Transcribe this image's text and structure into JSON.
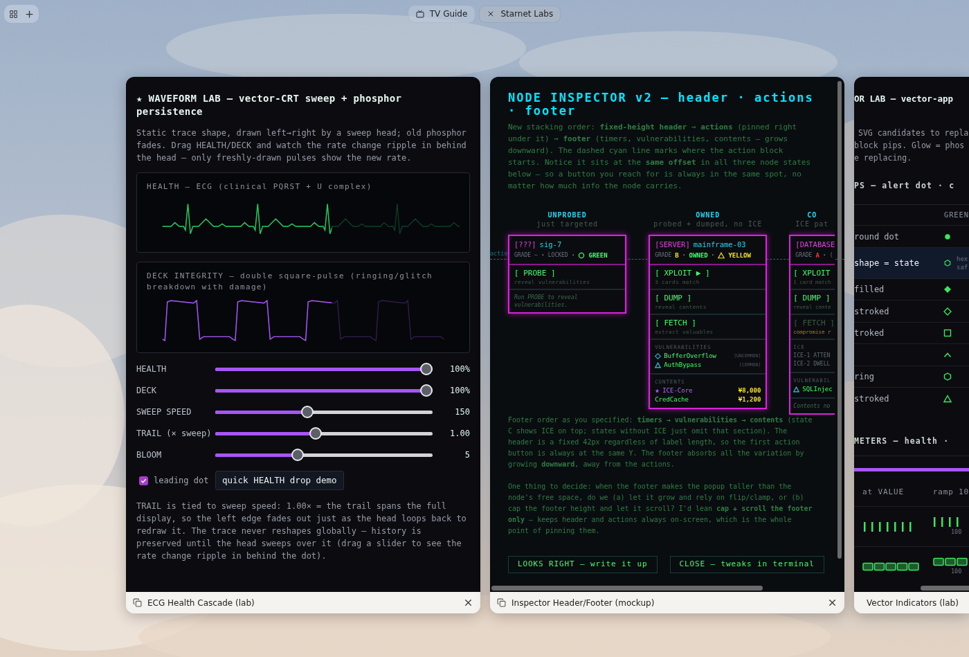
{
  "tabs": [
    {
      "label": "TV Guide",
      "selected": false
    },
    {
      "label": "Starnet Labs",
      "selected": true
    }
  ],
  "waveform_lab": {
    "title": "★ WAVEFORM LAB — vector-CRT sweep + phosphor persistence",
    "intro": "Static trace shape, drawn left→right by a sweep head; old phosphor fades. Drag HEALTH/DECK and watch the rate change ripple in behind the head — only freshly-drawn pulses show the new rate.",
    "scopes": [
      {
        "label": "HEALTH — ECG (clinical PQRST + U complex)",
        "kind": "ecg"
      },
      {
        "label": "DECK INTEGRITY — double square-pulse (ringing/glitch breakdown with damage)",
        "kind": "square"
      }
    ],
    "sliders": [
      {
        "label": "HEALTH",
        "level": 1,
        "reading": "100%"
      },
      {
        "label": "DECK",
        "level": 1,
        "reading": "100%"
      },
      {
        "label": "SWEEP SPEED",
        "level": 0.42,
        "reading": "150"
      },
      {
        "label": "TRAIL (× sweep)",
        "level": 0.46,
        "reading": "1.00"
      },
      {
        "label": "BLOOM",
        "level": 0.37,
        "reading": "5"
      }
    ],
    "checkbox": {
      "label": "leading dot",
      "checked": true
    },
    "button": "quick HEALTH drop demo",
    "note": "TRAIL is tied to sweep speed: 1.00× = the trail spans the full display, so the left edge fades out just as the head loops back to redraw it. The trace never reshapes globally — history is preserved until the head sweeps over it (drag a slider to see the rate change ripple in behind the dot).",
    "caption": "ECG Health Cascade (lab)"
  },
  "node_inspector": {
    "title": "NODE INSPECTOR v2 — header · actions · footer",
    "intro": "New stacking order: **fixed-height header** → **actions** (pinned right under it) → **footer** (timers, vulnerabilities, contents — grows downward). The dashed cyan line marks where the action block starts. Notice it sits at the **same offset** in all three node states below — so a button you reach for is always in the same spot, no matter how much info the node carries.",
    "marker_label": "actio",
    "columns": [
      {
        "heading": "UNPROBED",
        "subheading": "just targeted",
        "clipped": false,
        "node": {
          "type": "[???]",
          "name": "sig-7",
          "meta": [
            {
              "kind": "label",
              "text": "GRADE"
            },
            {
              "kind": "label",
              "text": "—"
            },
            {
              "kind": "separator",
              "text": "·"
            },
            {
              "kind": "label",
              "text": "LOCKED"
            },
            {
              "kind": "separator",
              "text": "·"
            },
            {
              "kind": "circle",
              "text": "GREEN",
              "color": "#39ff6a"
            }
          ],
          "actions": [
            {
              "label": "[ PROBE ]",
              "hint": "reveal vulnerabilities",
              "disabled": false
            }
          ],
          "sections": [
            {
              "kind": "note",
              "text": "Run PROBE to reveal vulnerabilities."
            }
          ]
        }
      },
      {
        "heading": "OWNED",
        "subheading": "probed + dumped, no ICE",
        "clipped": false,
        "node": {
          "type": "[SERVER]",
          "name": "mainframe-03",
          "meta": [
            {
              "kind": "label",
              "text": "GRADE"
            },
            {
              "kind": "text",
              "text": "B",
              "color": "#f5e60a"
            },
            {
              "kind": "separator",
              "text": "·"
            },
            {
              "kind": "text",
              "text": "OWNED",
              "color": "#39ff6a"
            },
            {
              "kind": "separator",
              "text": "·"
            },
            {
              "kind": "triangle",
              "text": "YELLOW",
              "color": "#f5e60a"
            }
          ],
          "actions": [
            {
              "label": "[ XPLOIT ▶ ]",
              "hint": "3 cards match",
              "disabled": false
            },
            {
              "label": "[ DUMP ]",
              "hint": "reveal contents",
              "disabled": false
            },
            {
              "label": "[ FETCH ]",
              "hint": "extract valuables",
              "disabled": false
            }
          ],
          "sections": [
            {
              "kind": "vulns",
              "title": "VULNERABILITIES",
              "items": [
                {
                  "kind": "diamond",
                  "name": "BufferOverflow",
                  "rarity": "[UNCOMMON]"
                },
                {
                  "kind": "triangle",
                  "name": "AuthBypass",
                  "rarity": "[COMMON]"
                }
              ]
            },
            {
              "kind": "contents",
              "title": "CONTENTS",
              "items": [
                {
                  "name": "ICE-Core",
                  "value": "¥8,000",
                  "rare": true
                },
                {
                  "name": "CredCache",
                  "value": "¥1,200",
                  "rare": false
                }
              ]
            }
          ]
        }
      },
      {
        "heading": "CO",
        "subheading": "ICE pat",
        "clipped": true,
        "node": {
          "type": "[DATABASE",
          "meta": [
            {
              "kind": "label",
              "text": "GRADE"
            },
            {
              "kind": "text",
              "text": "A",
              "color": "#ff3030"
            },
            {
              "kind": "separator",
              "text": "·"
            },
            {
              "kind": "label",
              "text": "("
            }
          ],
          "actions": [
            {
              "label": "[ XPLOIT",
              "hint": "1 card match",
              "disabled": false
            },
            {
              "label": "[ DUMP ]",
              "hint": "reveal conte",
              "disabled": false
            },
            {
              "label": "[ FETCH ]",
              "hint": "compromise r",
              "disabled": true
            }
          ],
          "sections": [
            {
              "kind": "ice",
              "title": "ICE",
              "items": [
                "ICE-1 ATTEN",
                "ICE-2 DWELL"
              ]
            },
            {
              "kind": "vulns",
              "title": "VULNERABIL",
              "items": [
                {
                  "kind": "triangle",
                  "name": "SQLInjec"
                }
              ]
            },
            {
              "kind": "note",
              "text": "Contents no"
            }
          ]
        }
      }
    ],
    "footer": [
      "Footer order as you specified: **timers → vulnerabilities → contents** (state C shows ICE on top; states without ICE just omit that section). The header is a fixed 42px regardless of label length, so the first action button is always at the same Y. The footer absorbs all the variation by growing **downward**, away from the actions.",
      "One thing to decide: when the footer makes the popup taller than the node's free space, do we (a) let it grow and rely on flip/clamp, or (b) cap the footer height and let it scroll? I'd lean **cap + scroll the footer only** — keeps header and actions always on-screen, which is the whole point of pinning them."
    ],
    "buttons": [
      "LOOKS RIGHT — write it up",
      "CLOSE — tweaks in terminal"
    ],
    "caption": "Inspector Header/Footer (mockup)"
  },
  "vector_indicators": {
    "title": "OR LAB — vector-app",
    "intro": [
      "SVG candidates to repla",
      "block pips. Glow = phos",
      "e replacing."
    ],
    "section_1": "PS  —  alert dot · c",
    "column_header": "GREEN",
    "rows": [
      {
        "label": "round dot",
        "kind": "dot",
        "selected": false
      },
      {
        "label": "shape = state",
        "kind": "hexagon-small",
        "selected": true,
        "note": [
          "hex",
          "saf"
        ]
      },
      {
        "label": "filled",
        "kind": "diamond-filled",
        "selected": false
      },
      {
        "label": "stroked",
        "kind": "diamond",
        "selected": false
      },
      {
        "label": "troked",
        "kind": "square",
        "selected": false
      },
      {
        "kind": "chevron",
        "selected": false
      },
      {
        "label": "ring",
        "kind": "hexagon",
        "selected": false
      },
      {
        "label": "stroked",
        "kind": "triangle",
        "selected": false
      }
    ],
    "section_2": "METERS  —  health ·",
    "meter_headers": [
      "at VALUE",
      "ramp",
      "10"
    ],
    "meters": [
      {
        "kind": "ticks",
        "reading": "100"
      },
      {
        "kind": "blocks",
        "reading": "100"
      }
    ],
    "caption": "Vector Indicators (lab)"
  }
}
